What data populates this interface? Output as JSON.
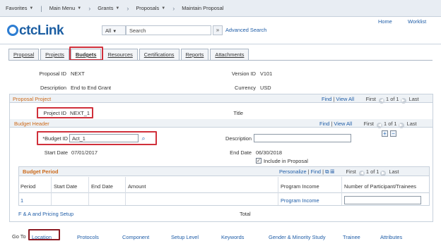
{
  "topnav": {
    "favorites": "Favorites",
    "main_menu": "Main Menu",
    "grants": "Grants",
    "proposals": "Proposals",
    "current": "Maintain Proposal"
  },
  "header": {
    "logo": "ctcLink",
    "search_scope": "All",
    "search_placeholder": "Search",
    "advanced_search": "Advanced Search",
    "home": "Home",
    "worklist": "Worklist"
  },
  "tabs": [
    "Proposal",
    "Projects",
    "Budgets",
    "Resources",
    "Certifications",
    "Reports",
    "Attachments"
  ],
  "proposal": {
    "id_label": "Proposal ID",
    "id_value": "NEXT",
    "desc_label": "Description",
    "desc_value": "End to End Grant",
    "version_label": "Version ID",
    "version_value": "V101",
    "currency_label": "Currency",
    "currency_value": "USD"
  },
  "proposal_project": {
    "title": "Proposal Project",
    "find": "Find",
    "view_all": "View All",
    "first": "First",
    "range": "1 of 1",
    "last": "Last",
    "project_id_label": "Project ID",
    "project_id_value": "NEXT_1",
    "title_label": "Title"
  },
  "budget_header": {
    "title": "Budget Header",
    "find": "Find",
    "view_all": "View All",
    "first": "First",
    "range": "1 of 1",
    "last": "Last",
    "budget_id_label": "*Budget ID",
    "budget_id_value": "Act_1",
    "description_label": "Description",
    "start_label": "Start Date",
    "start_value": "07/01/2017",
    "end_label": "End Date",
    "end_value": "06/30/2018",
    "include_label": "Include in Proposal"
  },
  "budget_period": {
    "title": "Budget Period",
    "personalize": "Personalize",
    "find": "Find",
    "first": "First",
    "range": "1 of 1",
    "last": "Last",
    "columns": [
      "Period",
      "Start Date",
      "End Date",
      "Amount",
      "Program Income",
      "Number of Participant/Trainees"
    ],
    "row": {
      "period": "1",
      "program_income": "Program Income"
    }
  },
  "fa_pricing": "F & A and Pricing Setup",
  "total_label": "Total",
  "goto": {
    "label": "Go To",
    "links": [
      "Location",
      "Protocols",
      "Component",
      "Setup Level",
      "Keywords",
      "Gender & Minority Study",
      "Trainee",
      "Attributes"
    ]
  }
}
